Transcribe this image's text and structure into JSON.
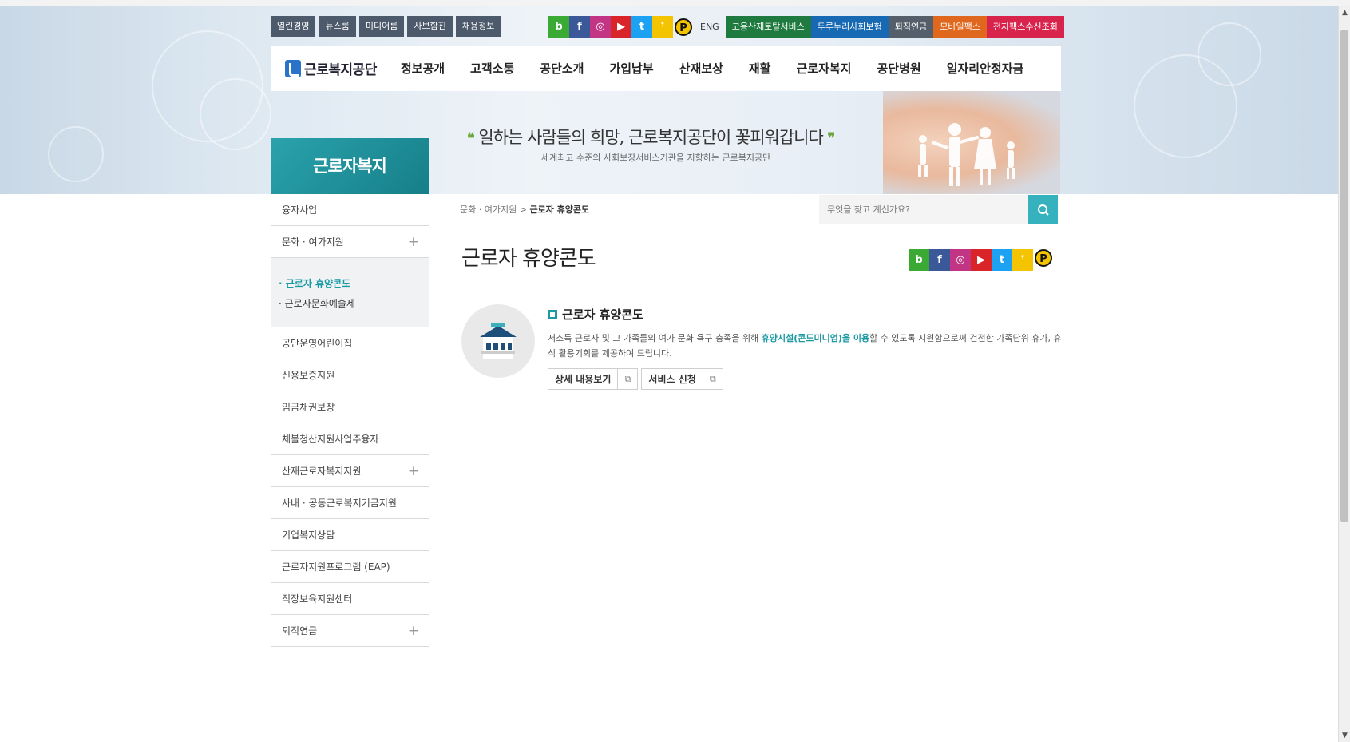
{
  "top_menu": {
    "left": [
      "열린경영",
      "뉴스룸",
      "미디어룸",
      "사보함진",
      "채용정보"
    ],
    "sns": [
      {
        "name": "blog-icon",
        "glyph": "b",
        "color": "#3aaa35"
      },
      {
        "name": "facebook-icon",
        "glyph": "f",
        "color": "#3b5998"
      },
      {
        "name": "instagram-icon",
        "glyph": "◎",
        "color": "#c13584"
      },
      {
        "name": "youtube-icon",
        "glyph": "▶",
        "color": "#d9252a"
      },
      {
        "name": "twitter-icon",
        "glyph": "t",
        "color": "#1da1f2"
      },
      {
        "name": "kakaostory-icon",
        "glyph": "❜",
        "color": "#f5c400"
      },
      {
        "name": "kakaopay-icon",
        "glyph": "P",
        "color": "#f5c400"
      }
    ],
    "eng": "ENG",
    "links": [
      {
        "label": "고용산재토탈서비스",
        "color": "#1f7a3f"
      },
      {
        "label": "두루누리사회보험",
        "color": "#1769b4"
      },
      {
        "label": "퇴직연금",
        "color": "#555f6b"
      },
      {
        "label": "모바일팩스",
        "color": "#e0681e"
      },
      {
        "label": "전자팩스수신조회",
        "color": "#d8234d"
      }
    ]
  },
  "logo": {
    "text": "근로복지공단"
  },
  "main_nav": [
    "정보공개",
    "고객소통",
    "공단소개",
    "가입납부",
    "산재보상",
    "재활",
    "근로자복지",
    "공단병원",
    "일자리안정자금"
  ],
  "hero": {
    "slogan": "일하는 사람들의 희망, 근로복지공단이 꽃피워갑니다",
    "sub": "세계최고 수준의 사회보장서비스기관을 지향하는 근로복지공단"
  },
  "sidebar": {
    "title": "근로자복지",
    "items_top": [
      {
        "label": "융자사업",
        "plus": ""
      },
      {
        "label": "문화 · 여가지원",
        "plus": "+"
      }
    ],
    "sub_items": [
      {
        "label": "· 근로자 휴양콘도"
      },
      {
        "label": "· 근로자문화예술제"
      }
    ],
    "items_bottom": [
      {
        "label": "공단운영어린이집",
        "plus": ""
      },
      {
        "label": "신용보증지원",
        "plus": ""
      },
      {
        "label": "임금채권보장",
        "plus": ""
      },
      {
        "label": "체불청산지원사업주융자",
        "plus": ""
      },
      {
        "label": "산재근로자복지지원",
        "plus": "+"
      },
      {
        "label": "사내 · 공동근로복지기금지원",
        "plus": ""
      },
      {
        "label": "기업복지상담",
        "plus": ""
      },
      {
        "label": "근로자지원프로그램 (EAP)",
        "plus": ""
      },
      {
        "label": "직장보육지원센터",
        "plus": ""
      },
      {
        "label": "퇴직연금",
        "plus": "+"
      }
    ]
  },
  "breadcrumb": {
    "parent": "문화 · 여가지원",
    "sep": ">",
    "current": "근로자 휴양콘도"
  },
  "search": {
    "placeholder": "무엇을 찾고 계신가요?"
  },
  "content": {
    "title": "근로자 휴양콘도",
    "service_title": "근로자 휴양콘도",
    "desc_before": "저소득 근로자 및 그 가족들의 여가 문화 욕구 충족을 위해 ",
    "desc_highlight": "휴양시설(콘도미니엄)을 이용",
    "desc_after": "할 수 있도록 지원함으로써 건전한 가족단위 휴가, 휴식 활용기회를 제공하여 드립니다.",
    "btn_detail": "상세 내용보기",
    "btn_apply": "서비스 신청"
  }
}
